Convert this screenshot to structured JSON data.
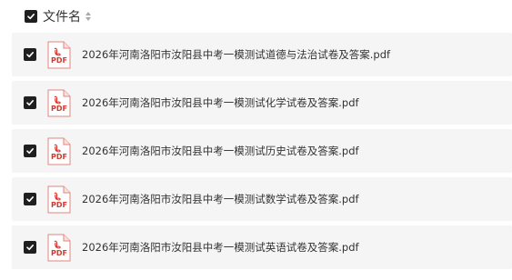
{
  "header": {
    "label": "文件名",
    "checked": true
  },
  "files": [
    {
      "name": "2026年河南洛阳市汝阳县中考一模测试道德与法治试卷及答案.pdf",
      "type_label": "PDF",
      "checked": true
    },
    {
      "name": "2026年河南洛阳市汝阳县中考一模测试化学试卷及答案.pdf",
      "type_label": "PDF",
      "checked": true
    },
    {
      "name": "2026年河南洛阳市汝阳县中考一模测试历史试卷及答案.pdf",
      "type_label": "PDF",
      "checked": true
    },
    {
      "name": "2026年河南洛阳市汝阳县中考一模测试数学试卷及答案.pdf",
      "type_label": "PDF",
      "checked": true
    },
    {
      "name": "2026年河南洛阳市汝阳县中考一模测试英语试卷及答案.pdf",
      "type_label": "PDF",
      "checked": true
    }
  ],
  "icons": {
    "checkbox": "check-icon",
    "sort": "sort-icon",
    "file": "pdf-file-icon"
  },
  "colors": {
    "checkbox_fill": "#1f1f1f",
    "pdf_red": "#d9362b",
    "row_background": "#f5f5f5",
    "text": "#333333"
  }
}
